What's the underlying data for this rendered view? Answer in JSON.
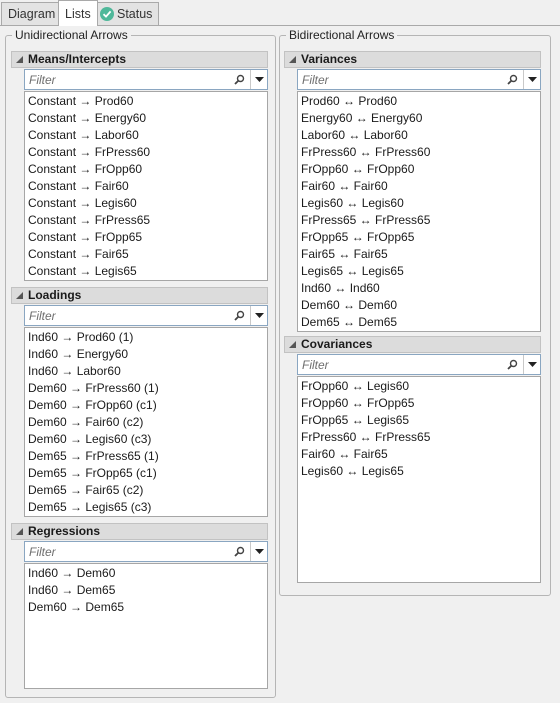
{
  "tabs": [
    {
      "label": "Diagram"
    },
    {
      "label": "Lists"
    },
    {
      "label": "Status"
    }
  ],
  "left_group": {
    "legend": "Unidirectional Arrows",
    "panels": [
      {
        "title": "Means/Intercepts",
        "filter_placeholder": "Filter",
        "items": [
          "Constant → Prod60",
          "Constant → Energy60",
          "Constant → Labor60",
          "Constant → FrPress60",
          "Constant → FrOpp60",
          "Constant → Fair60",
          "Constant → Legis60",
          "Constant → FrPress65",
          "Constant → FrOpp65",
          "Constant → Fair65",
          "Constant → Legis65"
        ]
      },
      {
        "title": "Loadings",
        "filter_placeholder": "Filter",
        "items": [
          "Ind60 → Prod60 (1)",
          "Ind60 → Energy60",
          "Ind60 → Labor60",
          "Dem60 → FrPress60 (1)",
          "Dem60 → FrOpp60 (c1)",
          "Dem60 → Fair60 (c2)",
          "Dem60 → Legis60 (c3)",
          "Dem65 → FrPress65 (1)",
          "Dem65 → FrOpp65 (c1)",
          "Dem65 → Fair65 (c2)",
          "Dem65 → Legis65 (c3)"
        ]
      },
      {
        "title": "Regressions",
        "filter_placeholder": "Filter",
        "items": [
          "Ind60 → Dem60",
          "Ind60 → Dem65",
          "Dem60 → Dem65"
        ]
      }
    ]
  },
  "right_group": {
    "legend": "Bidirectional Arrows",
    "panels": [
      {
        "title": "Variances",
        "filter_placeholder": "Filter",
        "items": [
          "Prod60 ↔ Prod60",
          "Energy60 ↔ Energy60",
          "Labor60 ↔ Labor60",
          "FrPress60 ↔ FrPress60",
          "FrOpp60 ↔ FrOpp60",
          "Fair60 ↔ Fair60",
          "Legis60 ↔ Legis60",
          "FrPress65 ↔ FrPress65",
          "FrOpp65 ↔ FrOpp65",
          "Fair65 ↔ Fair65",
          "Legis65 ↔ Legis65",
          "Ind60 ↔ Ind60",
          "Dem60 ↔ Dem60",
          "Dem65 ↔ Dem65"
        ]
      },
      {
        "title": "Covariances",
        "filter_placeholder": "Filter",
        "items": [
          "FrOpp60 ↔ Legis60",
          "FrOpp60 ↔ FrOpp65",
          "FrOpp65 ↔ Legis65",
          "FrPress60 ↔ FrPress65",
          "Fair60 ↔ Fair65",
          "Legis60 ↔ Legis65"
        ]
      }
    ]
  },
  "colors": {
    "status_check": "#4fb89a",
    "filter_border": "#8aa6c1",
    "header_bg": "#dcdcdc"
  }
}
